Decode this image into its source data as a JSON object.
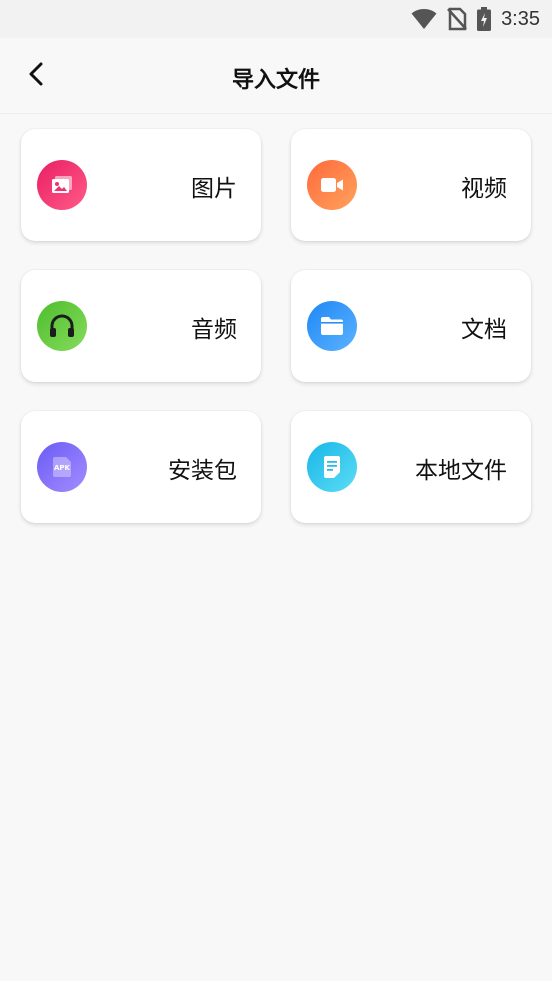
{
  "status_bar": {
    "time": "3:35",
    "icons": [
      "wifi-icon",
      "no-sim-icon",
      "battery-charging-icon"
    ]
  },
  "app_bar": {
    "title": "导入文件",
    "back_icon": "back-arrow-icon"
  },
  "categories": [
    {
      "label": "图片",
      "icon": "image-icon",
      "colors": [
        "#e91e63",
        "#ff5b88"
      ]
    },
    {
      "label": "视频",
      "icon": "video-icon",
      "colors": [
        "#ff6a3c",
        "#ffa25c"
      ]
    },
    {
      "label": "音频",
      "icon": "headphones-icon",
      "colors": [
        "#4ebd2d",
        "#86dc5c"
      ]
    },
    {
      "label": "文档",
      "icon": "folder-icon",
      "colors": [
        "#1e88f5",
        "#5cb2ff"
      ]
    },
    {
      "label": "安装包",
      "icon": "apk-icon",
      "colors": [
        "#6a5cf5",
        "#a48cff"
      ]
    },
    {
      "label": "本地文件",
      "icon": "file-icon",
      "colors": [
        "#17b7e8",
        "#5ddcf5"
      ]
    }
  ]
}
